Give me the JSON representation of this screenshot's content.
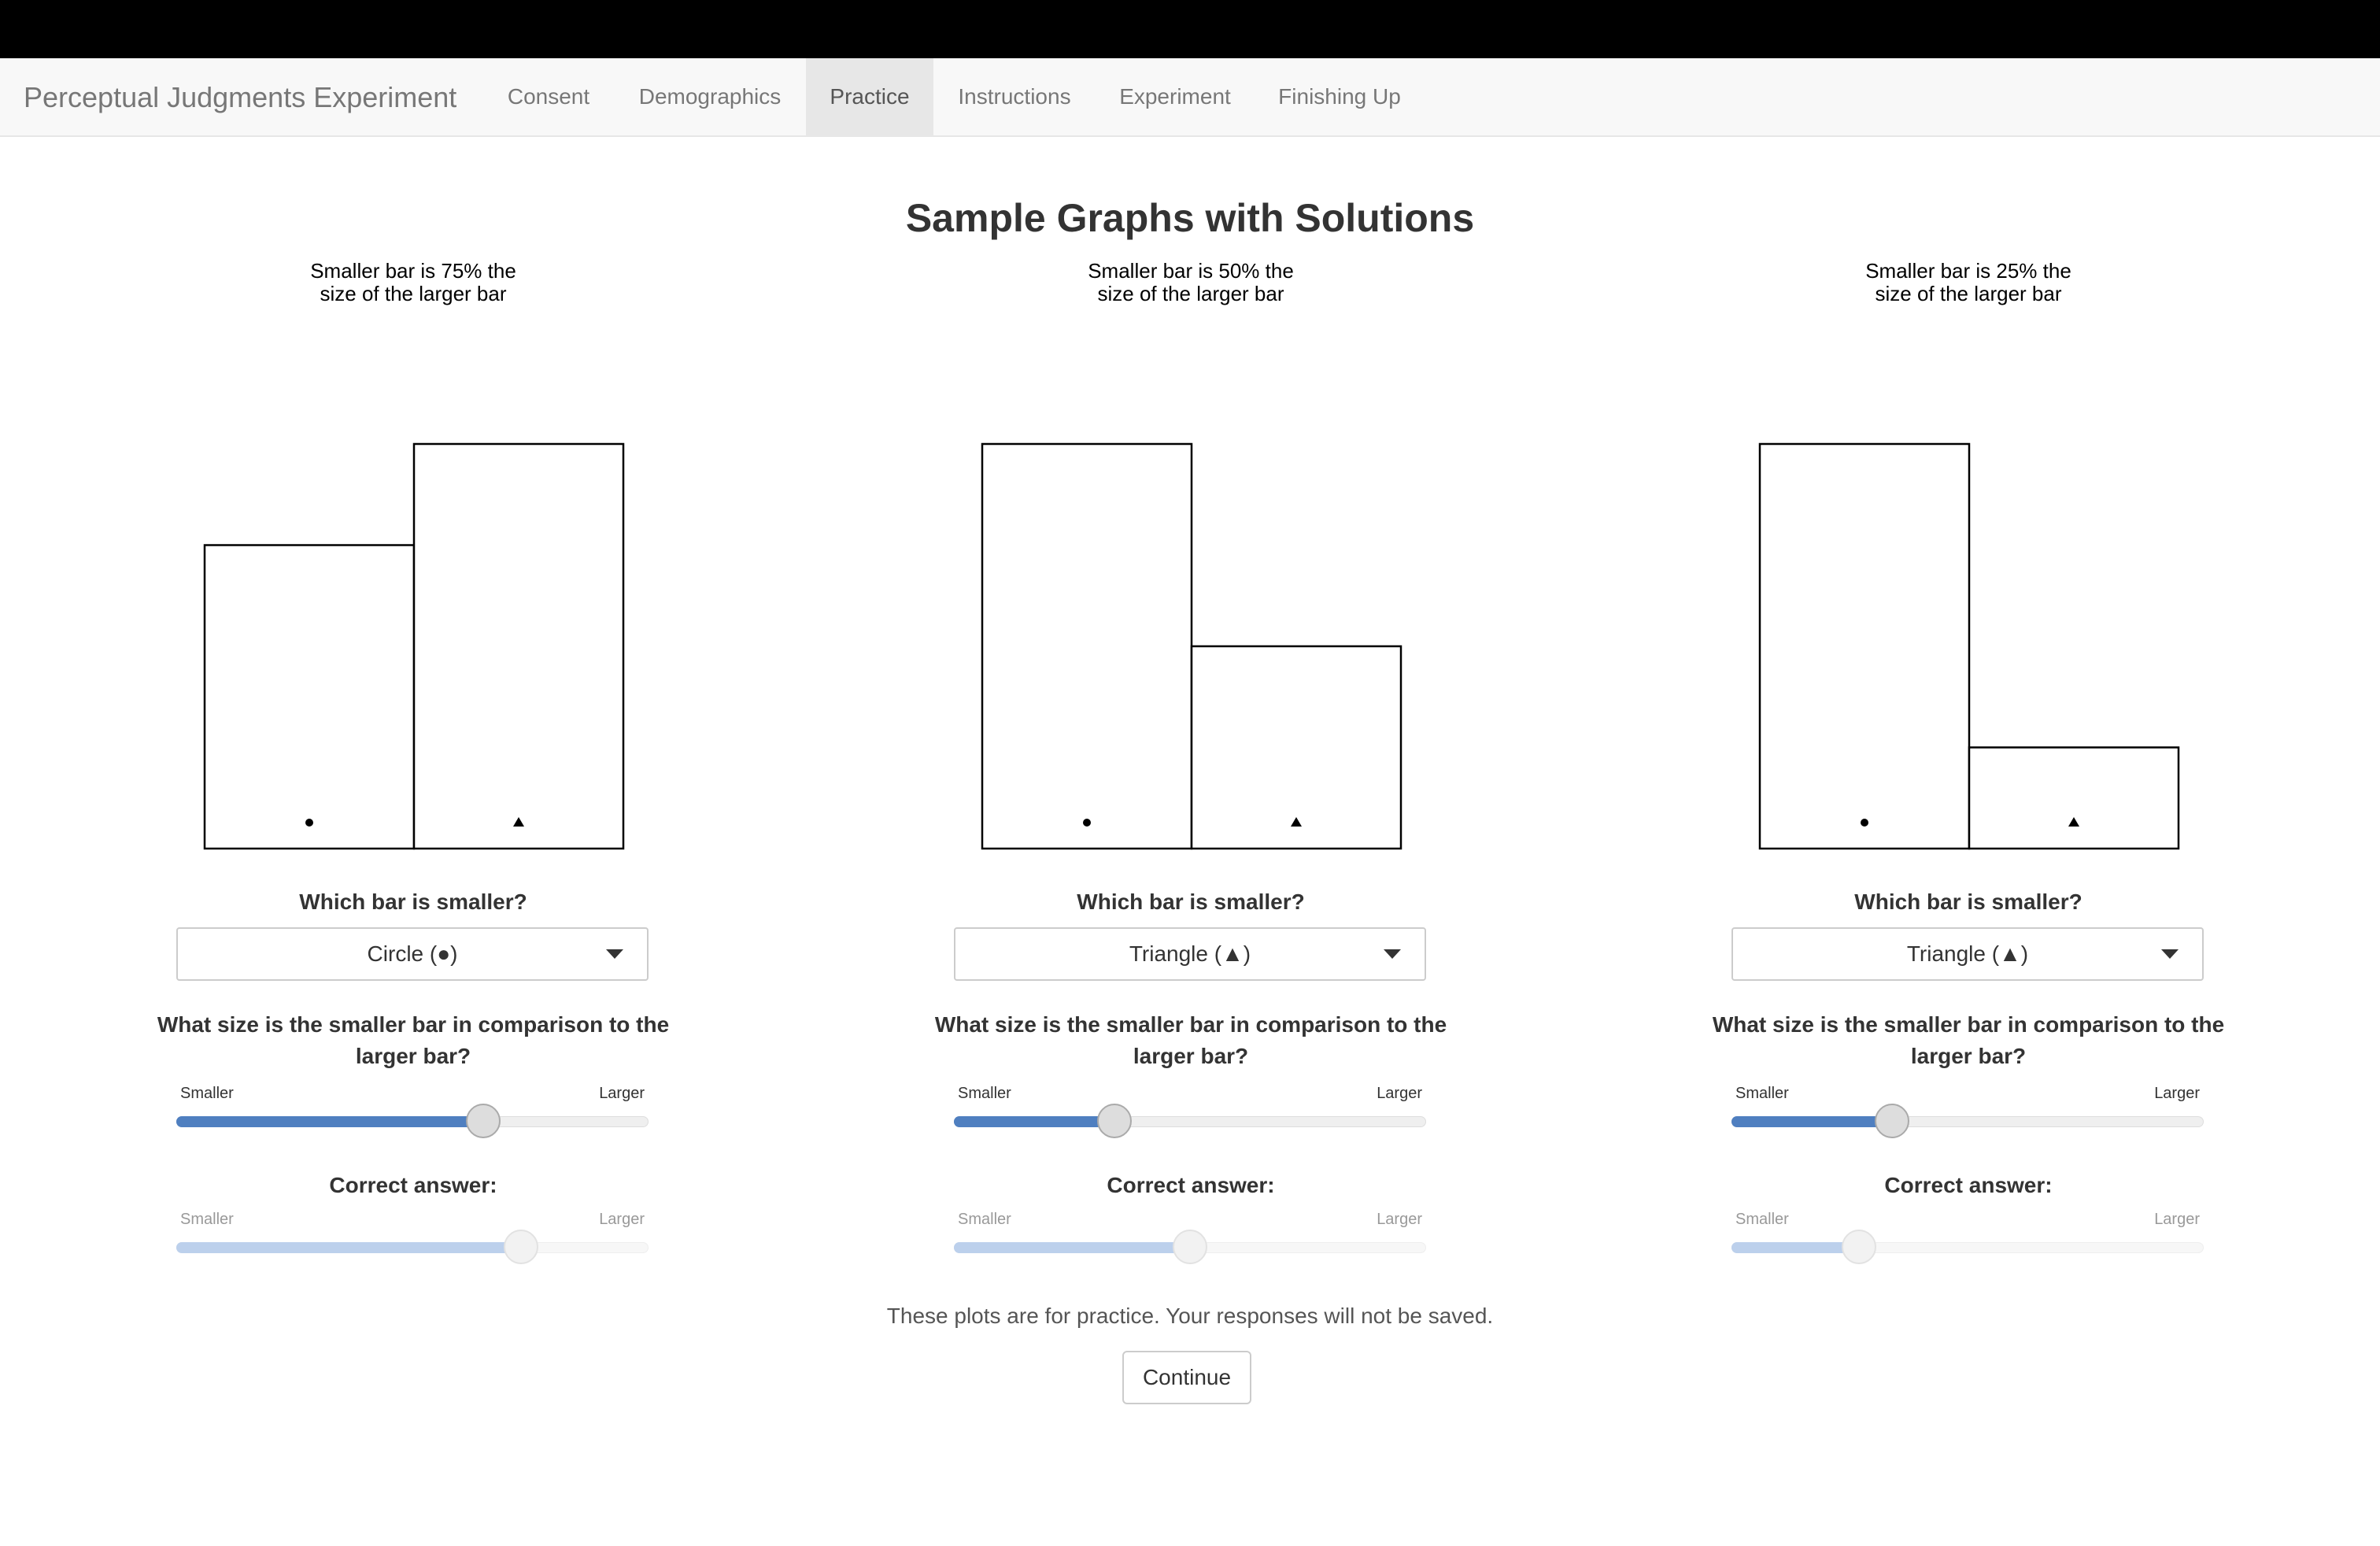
{
  "navbar": {
    "brand": "Perceptual Judgments Experiment",
    "tabs": [
      {
        "label": "Consent",
        "active": false
      },
      {
        "label": "Demographics",
        "active": false
      },
      {
        "label": "Practice",
        "active": true
      },
      {
        "label": "Instructions",
        "active": false
      },
      {
        "label": "Experiment",
        "active": false
      },
      {
        "label": "Finishing Up",
        "active": false
      }
    ]
  },
  "main": {
    "title": "Sample Graphs with Solutions",
    "practice_note": "These plots are for practice. Your responses will not be saved.",
    "continue_label": "Continue"
  },
  "panels": [
    {
      "chart_title": "Smaller bar is 75% the\nsize of the larger bar",
      "question_which": "Which bar is smaller?",
      "selected_option": "Circle (●)",
      "question_size": "What size is the smaller bar in comparison to the larger bar?",
      "slider_min_label": "Smaller",
      "slider_max_label": "Larger",
      "response_value": 0.65,
      "correct_label": "Correct answer:",
      "correct_value": 0.73
    },
    {
      "chart_title": "Smaller bar is 50% the\nsize of the larger bar",
      "question_which": "Which bar is smaller?",
      "selected_option": "Triangle (▲)",
      "question_size": "What size is the smaller bar in comparison to the larger bar?",
      "slider_min_label": "Smaller",
      "slider_max_label": "Larger",
      "response_value": 0.34,
      "correct_label": "Correct answer:",
      "correct_value": 0.5
    },
    {
      "chart_title": "Smaller bar is 25% the\nsize of the larger bar",
      "question_which": "Which bar is smaller?",
      "selected_option": "Triangle (▲)",
      "question_size": "What size is the smaller bar in comparison to the larger bar?",
      "slider_min_label": "Smaller",
      "slider_max_label": "Larger",
      "response_value": 0.34,
      "correct_label": "Correct answer:",
      "correct_value": 0.27
    }
  ],
  "chart_data": [
    {
      "type": "bar",
      "title": "Smaller bar is 75% the size of the larger bar",
      "categories": [
        "circle",
        "triangle"
      ],
      "markers": [
        "●",
        "▲"
      ],
      "values": [
        75,
        100
      ],
      "ylim": [
        0,
        100
      ],
      "grid": false
    },
    {
      "type": "bar",
      "title": "Smaller bar is 50% the size of the larger bar",
      "categories": [
        "circle",
        "triangle"
      ],
      "markers": [
        "●",
        "▲"
      ],
      "values": [
        100,
        50
      ],
      "ylim": [
        0,
        100
      ],
      "grid": false
    },
    {
      "type": "bar",
      "title": "Smaller bar is 25% the size of the larger bar",
      "categories": [
        "circle",
        "triangle"
      ],
      "markers": [
        "●",
        "▲"
      ],
      "values": [
        100,
        25
      ],
      "ylim": [
        0,
        100
      ],
      "grid": false
    }
  ],
  "colors": {
    "slider_fill": "#4f7fc0",
    "slider_fill_disabled": "#bcd0ec",
    "nav_active_bg": "#e7e7e7"
  }
}
